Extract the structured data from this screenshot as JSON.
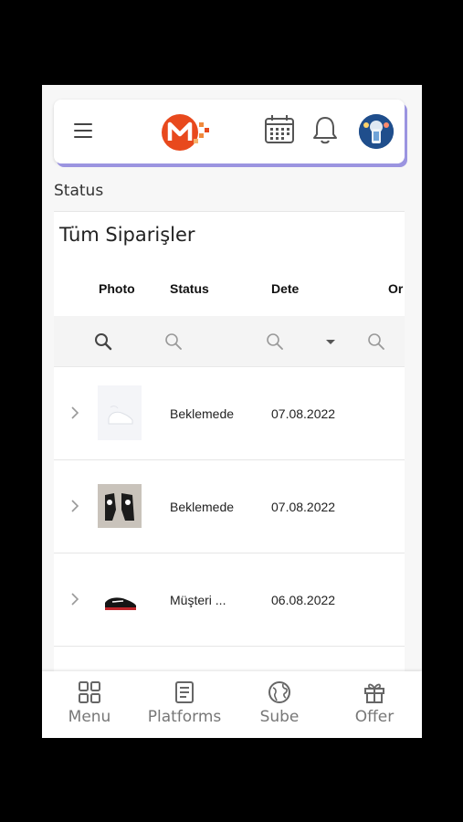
{
  "app": {
    "brand_letter": "M"
  },
  "section": {
    "status_label": "Status",
    "selected_status": "Tüm Siparişler"
  },
  "table": {
    "columns": [
      "Photo",
      "Status",
      "Dete",
      "Or"
    ],
    "rows": [
      {
        "status": "Beklemede",
        "date": "07.08.2022",
        "photo": "white-sneaker-photo"
      },
      {
        "status": "Beklemede",
        "date": "07.08.2022",
        "photo": "shoes-pair-photo"
      },
      {
        "status": "Müşteri ...",
        "date": "06.08.2022",
        "photo": "black-red-sneaker-photo"
      }
    ]
  },
  "nav": {
    "items": [
      {
        "label": "Menu",
        "icon": "grid-icon"
      },
      {
        "label": "Platforms",
        "icon": "document-icon"
      },
      {
        "label": "Sube",
        "icon": "globe-icon"
      },
      {
        "label": "Offer",
        "icon": "gift-icon"
      }
    ]
  },
  "colors": {
    "brand_orange": "#e8491d",
    "header_shadow": "#9b94e0",
    "avatar_blue": "#1f4e8c"
  }
}
